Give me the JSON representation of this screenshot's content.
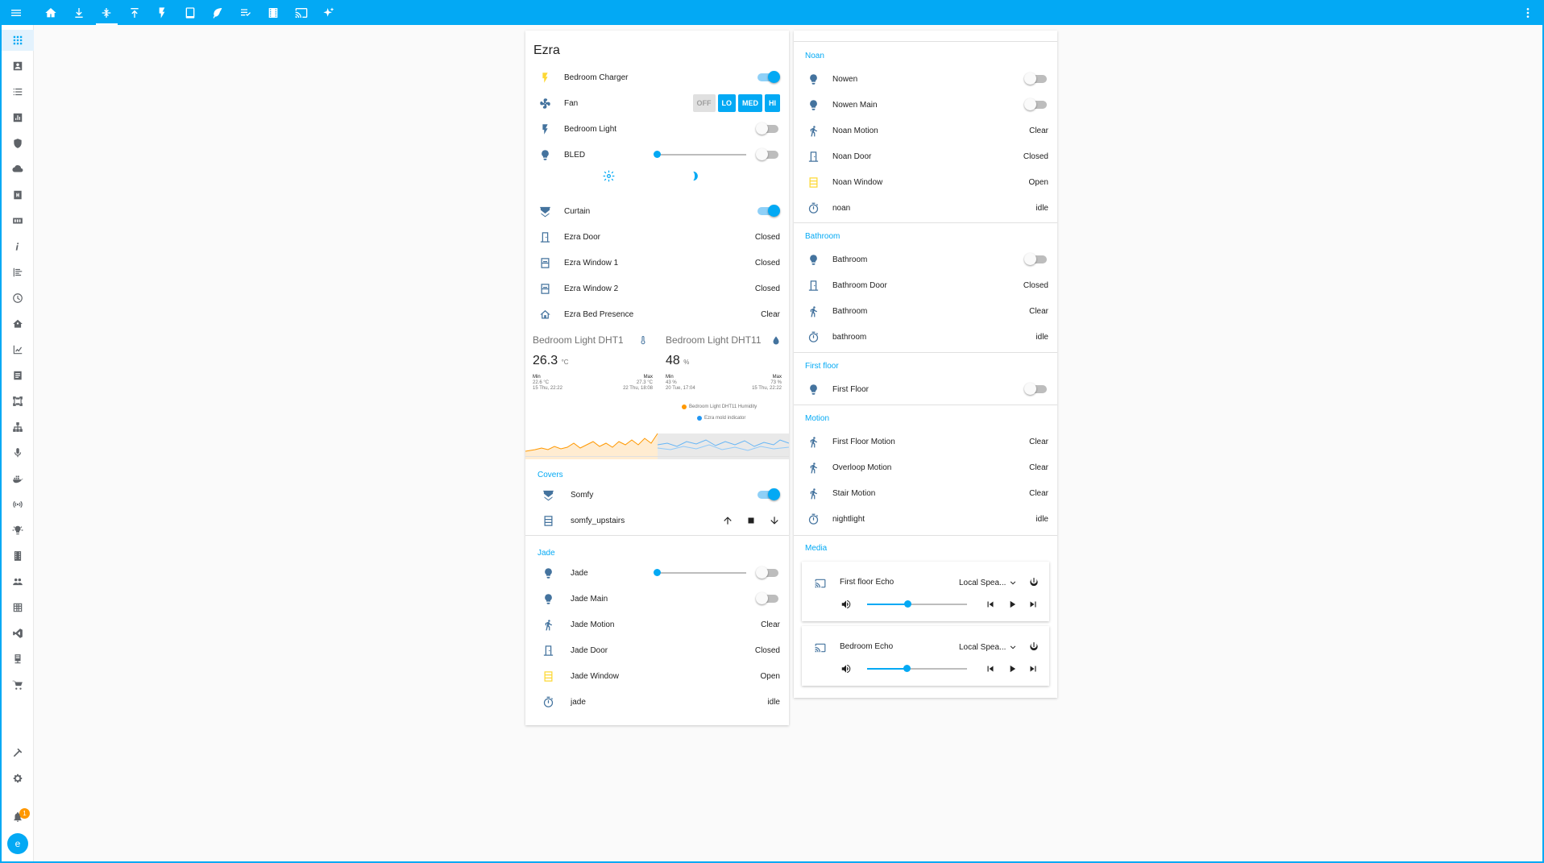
{
  "ezra": {
    "title": "Ezra",
    "rows": [
      {
        "name": "Bedroom Charger",
        "toggle": true
      },
      {
        "name": "Fan"
      },
      {
        "name": "Bedroom Light",
        "toggle": false
      },
      {
        "name": "BLED",
        "toggle": false
      },
      {
        "name": "Curtain",
        "toggle": true
      },
      {
        "name": "Ezra Door",
        "state": "Closed"
      },
      {
        "name": "Ezra Window 1",
        "state": "Closed"
      },
      {
        "name": "Ezra Window 2",
        "state": "Closed"
      },
      {
        "name": "Ezra Bed Presence",
        "state": "Clear"
      }
    ],
    "fan_buttons": [
      "OFF",
      "LO",
      "MED",
      "HI"
    ],
    "bled_brightness": 0,
    "sensors": [
      {
        "name": "Bedroom Light DHT11 T...",
        "value": "26.3",
        "unit": "°C",
        "min_label": "Min",
        "min_value": "22.6 °C",
        "min_time": "15 Thu, 22:22",
        "max_label": "Max",
        "max_value": "27.3 °C",
        "max_time": "22 Thu, 18:08"
      },
      {
        "name": "Bedroom Light DHT11 ...",
        "value": "48",
        "unit": "%",
        "min_label": "Min",
        "min_value": "43 %",
        "min_time": "20 Tue, 17:04",
        "max_label": "Max",
        "max_value": "73 %",
        "max_time": "15 Thu, 22:22"
      }
    ],
    "legend": [
      {
        "label": "Bedroom Light DHT11 Humidity",
        "color": "#ff9800"
      },
      {
        "label": "Ezra mold indicator",
        "color": "#2196f3"
      }
    ]
  },
  "covers": {
    "title": "Covers",
    "rows": [
      {
        "name": "Somfy",
        "toggle": true
      },
      {
        "name": "somfy_upstairs"
      }
    ]
  },
  "jade": {
    "title": "Jade",
    "brightness": 0,
    "rows": [
      {
        "name": "Jade",
        "toggle": false
      },
      {
        "name": "Jade Main",
        "toggle": false
      },
      {
        "name": "Jade Motion",
        "state": "Clear"
      },
      {
        "name": "Jade Door",
        "state": "Closed"
      },
      {
        "name": "Jade Window",
        "state": "Open"
      },
      {
        "name": "jade",
        "state": "idle"
      }
    ]
  },
  "noan": {
    "title": "Noan",
    "rows": [
      {
        "name": "Nowen",
        "toggle": false
      },
      {
        "name": "Nowen Main",
        "toggle": false
      },
      {
        "name": "Noan Motion",
        "state": "Clear"
      },
      {
        "name": "Noan Door",
        "state": "Closed"
      },
      {
        "name": "Noan Window",
        "state": "Open"
      },
      {
        "name": "noan",
        "state": "idle"
      }
    ]
  },
  "bathroom": {
    "title": "Bathroom",
    "rows": [
      {
        "name": "Bathroom",
        "toggle": false
      },
      {
        "name": "Bathroom Door",
        "state": "Closed"
      },
      {
        "name": "Bathroom",
        "state": "Clear"
      },
      {
        "name": "bathroom",
        "state": "idle"
      }
    ]
  },
  "first_floor": {
    "title": "First floor",
    "rows": [
      {
        "name": "First Floor",
        "toggle": false
      }
    ]
  },
  "motion": {
    "title": "Motion",
    "rows": [
      {
        "name": "First Floor Motion",
        "state": "Clear"
      },
      {
        "name": "Overloop Motion",
        "state": "Clear"
      },
      {
        "name": "Stair Motion",
        "state": "Clear"
      },
      {
        "name": "nightlight",
        "state": "idle"
      }
    ]
  },
  "media": {
    "title": "Media",
    "players": [
      {
        "name": "First floor Echo",
        "source": "Local Spea...",
        "volume": 0.4
      },
      {
        "name": "Bedroom Echo",
        "source": "Local Spea...",
        "volume": 0.39
      }
    ]
  },
  "colors": {
    "accent": "#03a9f4",
    "icon": "#44739e",
    "warning": "#fdd835",
    "badge": "#ff9800"
  },
  "notifications": {
    "count": "1"
  },
  "user": {
    "initial": "e"
  }
}
